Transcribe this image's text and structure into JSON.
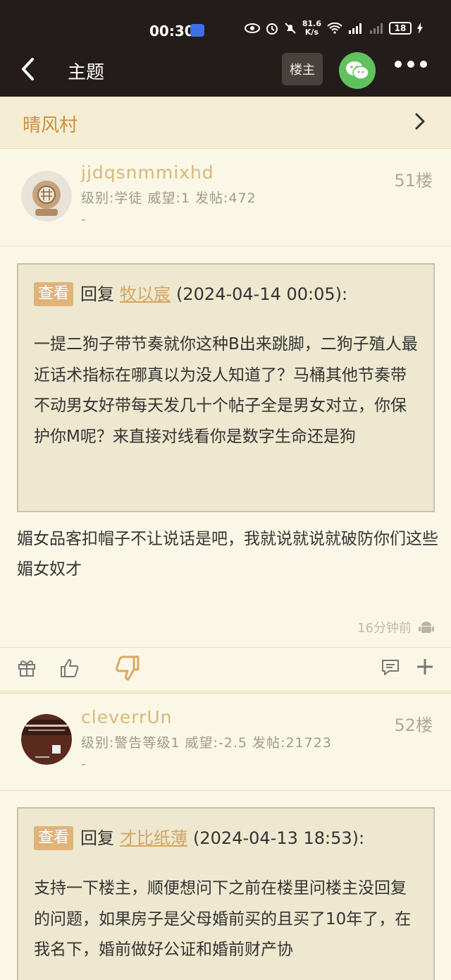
{
  "status_bar": {
    "time": "00:30",
    "net_speed_top": "81.6",
    "net_speed_bottom": "K/s",
    "battery": "18"
  },
  "topbar": {
    "title": "主题",
    "owner_label": "楼主"
  },
  "forum": {
    "name": "晴风村"
  },
  "posts": [
    {
      "username": "jjdqsnmmixhd",
      "userinfo": "级别:学徒 威望:1 发帖:472",
      "signature": "-",
      "floor": "51楼",
      "quote": {
        "badge": "查看",
        "reply_word": "回复",
        "user": "牧以宸",
        "date": "(2024-04-14 00:05):",
        "body": "一提二狗子带节奏就你这种B出来跳脚，二狗子殖人最近话术指标在哪真以为没人知道了？马桶其他节奏带不动男女好带每天发几十个帖子全是男女对立，你保护你M呢？来直接对线看你是数字生命还是狗"
      },
      "content": "媚女品客扣帽子不让说话是吧，我就说就说就破防你们这些媚女奴才",
      "time": "16分钟前"
    },
    {
      "username": "cleverrUn",
      "userinfo": "级别:警告等级1 威望:-2.5 发帖:21723",
      "signature": "-",
      "floor": "52楼",
      "quote": {
        "badge": "查看",
        "reply_word": "回复",
        "user": "才比纸薄",
        "date": "(2024-04-13 18:53):",
        "body": "支持一下楼主，顺便想问下之前在楼里问楼主没回复的问题，如果房子是父母婚前买的且买了10年了，在我名下，婚前做好公证和婚前财产协"
      }
    }
  ]
}
